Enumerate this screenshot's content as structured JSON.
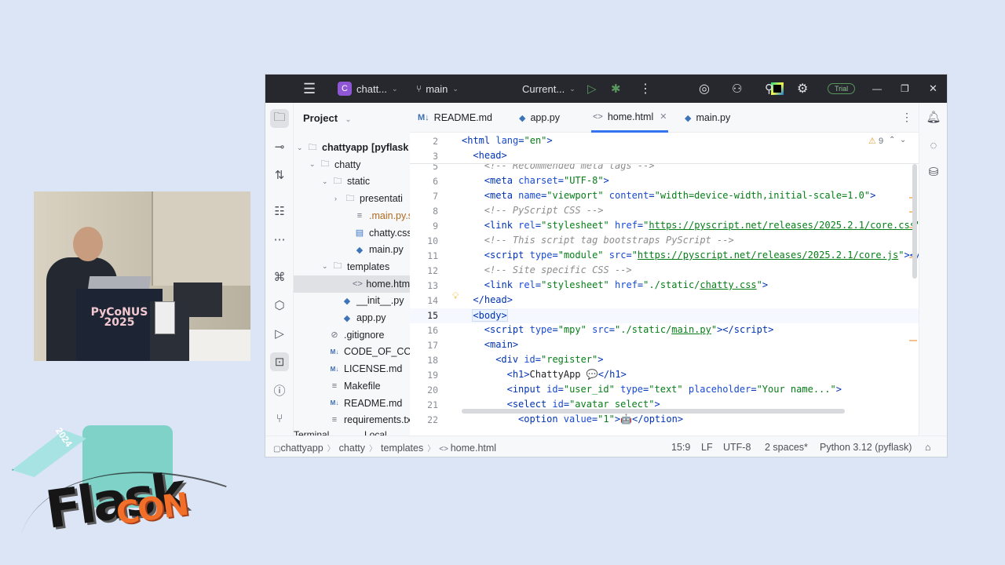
{
  "titlebar": {
    "project_badge": "C",
    "project_name": "chatt...",
    "branch": "main",
    "run_config": "Current...",
    "trial_label": "Trial"
  },
  "project_panel": {
    "title": "Project",
    "tree": [
      {
        "label": "chattyapp",
        "suffix": "[pyflask",
        "type": "folder"
      },
      {
        "label": "chatty",
        "type": "folder"
      },
      {
        "label": "static",
        "type": "folder"
      },
      {
        "label": "presentati",
        "type": "folder"
      },
      {
        "label": ".main.py.s",
        "type": "file"
      },
      {
        "label": "chatty.css",
        "type": "css"
      },
      {
        "label": "main.py",
        "type": "py"
      },
      {
        "label": "templates",
        "type": "folder"
      },
      {
        "label": "home.htm",
        "type": "html"
      },
      {
        "label": "__init__.py",
        "type": "py"
      },
      {
        "label": "app.py",
        "type": "py"
      },
      {
        "label": ".gitignore",
        "type": "ignore"
      },
      {
        "label": "CODE_OF_CON",
        "type": "md"
      },
      {
        "label": "LICENSE.md",
        "type": "md"
      },
      {
        "label": "Makefile",
        "type": "file"
      },
      {
        "label": "README.md",
        "type": "md"
      },
      {
        "label": "requirements.tx",
        "type": "file"
      }
    ],
    "bottom_tabs": [
      "Terminal",
      "Local"
    ]
  },
  "tabs": [
    {
      "label": "README.md",
      "icon": "M↓"
    },
    {
      "label": "app.py",
      "icon": "py"
    },
    {
      "label": "home.html",
      "icon": "<>",
      "active": true
    },
    {
      "label": "main.py",
      "icon": "py"
    }
  ],
  "editor": {
    "warnings_count": "9",
    "sticky": [
      {
        "n": "2",
        "html": "<span class=\"c-tag\">&lt;html </span><span class=\"c-attr\">lang</span><span class=\"c-tag\">=</span><span class=\"c-val\">\"en\"</span><span class=\"c-tag\">&gt;</span>",
        "indent": 0
      },
      {
        "n": "3",
        "html": "<span class=\"c-tag\">&lt;head&gt;</span>",
        "indent": 1
      }
    ],
    "lines": [
      {
        "n": "5",
        "html": "<span class=\"c-cmt\">&lt;!-- Recommended meta tags --&gt;</span>",
        "indent": 2
      },
      {
        "n": "6",
        "html": "<span class=\"c-tag\">&lt;meta </span><span class=\"c-attr\">charset</span><span class=\"c-tag\">=</span><span class=\"c-val\">\"UTF-8\"</span><span class=\"c-tag\">&gt;</span>",
        "indent": 2
      },
      {
        "n": "7",
        "html": "<span class=\"c-tag\">&lt;meta </span><span class=\"c-attr\">name</span><span class=\"c-tag\">=</span><span class=\"c-val\">\"viewport\"</span> <span class=\"c-attr\">content</span><span class=\"c-tag\">=</span><span class=\"c-val\">\"width=device-width,initial-scale=1.0\"</span><span class=\"c-tag\">&gt;</span>",
        "indent": 2
      },
      {
        "n": "8",
        "html": "<span class=\"c-cmt\">&lt;!-- PyScript CSS --&gt;</span>",
        "indent": 2
      },
      {
        "n": "9",
        "html": "<span class=\"c-tag\">&lt;link </span><span class=\"c-attr\">rel</span><span class=\"c-tag\">=</span><span class=\"c-val\">\"stylesheet\"</span> <span class=\"c-attr\">href</span><span class=\"c-tag\">=</span><span class=\"c-val\">\"</span><span class=\"c-url\">https://pyscript.net/releases/2025.2.1/core.css</span><span class=\"c-val\">\"</span>",
        "indent": 2
      },
      {
        "n": "10",
        "html": "<span class=\"c-cmt\">&lt;!-- This script tag bootstraps PyScript --&gt;</span>",
        "indent": 2
      },
      {
        "n": "11",
        "html": "<span class=\"c-tag\">&lt;script </span><span class=\"c-attr\">type</span><span class=\"c-tag\">=</span><span class=\"c-val\">\"module\"</span> <span class=\"c-attr\">src</span><span class=\"c-tag\">=</span><span class=\"c-val\">\"</span><span class=\"c-url\">https://pyscript.net/releases/2025.2.1/core.js</span><span class=\"c-val\">\"</span><span class=\"c-tag\">&gt;&lt;/</span>",
        "indent": 2
      },
      {
        "n": "12",
        "html": "<span class=\"c-cmt\">&lt;!-- Site specific CSS --&gt;</span>",
        "indent": 2
      },
      {
        "n": "13",
        "html": "<span class=\"c-tag\">&lt;link </span><span class=\"c-attr\">rel</span><span class=\"c-tag\">=</span><span class=\"c-val\">\"stylesheet\"</span> <span class=\"c-attr\">href</span><span class=\"c-tag\">=</span><span class=\"c-val\">\"./static/</span><span class=\"c-url\">chatty.css</span><span class=\"c-val\">\"</span><span class=\"c-tag\">&gt;</span>",
        "indent": 2
      },
      {
        "n": "14",
        "html": "<span class=\"c-tag\">&lt;/head&gt;</span>",
        "indent": 1
      },
      {
        "n": "15",
        "html": "<span class=\"c-tag c-body\">&lt;body&gt;</span><span class=\"caret\"></span>",
        "indent": 1,
        "current": true
      },
      {
        "n": "16",
        "html": "<span class=\"c-tag\">&lt;script </span><span class=\"c-attr\">type</span><span class=\"c-tag\">=</span><span class=\"c-val\">\"mpy\"</span> <span class=\"c-attr\">src</span><span class=\"c-tag\">=</span><span class=\"c-val\">\"./static/</span><span class=\"c-url\">main.py</span><span class=\"c-val\">\"</span><span class=\"c-tag\">&gt;&lt;/script&gt;</span>",
        "indent": 2
      },
      {
        "n": "17",
        "html": "<span class=\"c-tag\">&lt;main&gt;</span>",
        "indent": 2
      },
      {
        "n": "18",
        "html": "<span class=\"c-tag\">&lt;div </span><span class=\"c-attr\">id</span><span class=\"c-tag\">=</span><span class=\"c-val\">\"register\"</span><span class=\"c-tag\">&gt;</span>",
        "indent": 3
      },
      {
        "n": "19",
        "html": "<span class=\"c-tag\">&lt;h1&gt;</span><span class=\"c-txt\">ChattyApp 💬</span><span class=\"c-tag\">&lt;/h1&gt;</span>",
        "indent": 4
      },
      {
        "n": "20",
        "html": "<span class=\"c-tag\">&lt;input </span><span class=\"c-attr\">id</span><span class=\"c-tag\">=</span><span class=\"c-val\">\"user_id\"</span> <span class=\"c-attr\">type</span><span class=\"c-tag\">=</span><span class=\"c-val\">\"text\"</span> <span class=\"c-attr\">placeholder</span><span class=\"c-tag\">=</span><span class=\"c-val\">\"Your name...\"</span><span class=\"c-tag\">&gt;</span>",
        "indent": 4
      },
      {
        "n": "21",
        "html": "<span class=\"c-tag\">&lt;select </span><span class=\"c-attr\">id</span><span class=\"c-tag\">=</span><span class=\"c-val\">\"avatar_select\"</span><span class=\"c-tag\">&gt;</span>",
        "indent": 4
      },
      {
        "n": "22",
        "html": "<span class=\"c-tag\">&lt;option </span><span class=\"c-attr\">value</span><span class=\"c-tag\">=</span><span class=\"c-val\">\"1\"</span><span class=\"c-tag\">&gt;</span><span class=\"c-txt\">🤖</span><span class=\"c-tag\">&lt;/option&gt;</span>",
        "indent": 5
      }
    ]
  },
  "statusbar": {
    "breadcrumb": [
      "chattyapp",
      "chatty",
      "templates",
      "home.html"
    ],
    "position": "15:9",
    "line_sep": "LF",
    "encoding": "UTF-8",
    "indent": "2 spaces*",
    "interpreter": "Python 3.12 (pyflask)"
  },
  "video": {
    "podium_text": "PyCoNUS\n2025"
  },
  "logo": {
    "kite_text": "2024",
    "word1": "Flask",
    "word2": "CON"
  },
  "colors": {
    "titlebar": "#27282e",
    "accent": "#3574f0",
    "tag": "#0033b3",
    "string": "#067d17",
    "comment": "#8c8c8c"
  }
}
